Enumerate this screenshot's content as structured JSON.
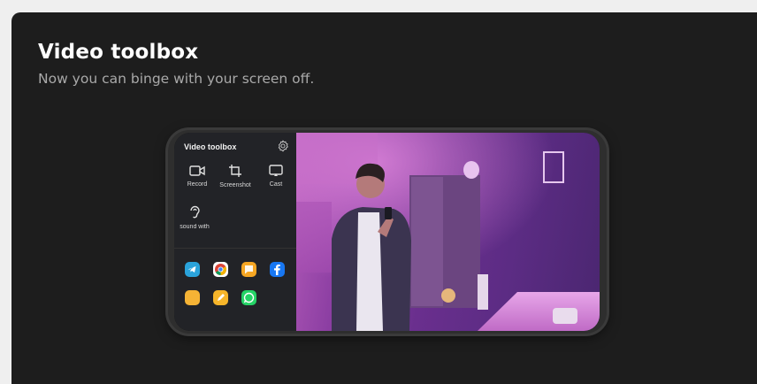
{
  "header": {
    "title": "Video toolbox",
    "subtitle": "Now you can binge with your screen off."
  },
  "toolbox": {
    "title": "Video toolbox",
    "settings_icon": "gear-icon",
    "tools": [
      {
        "label": "Record",
        "icon": "record-icon"
      },
      {
        "label": "Screenshot",
        "icon": "crop-icon"
      },
      {
        "label": "Cast",
        "icon": "cast-icon"
      },
      {
        "label": "sound with",
        "icon": "ear-icon"
      }
    ],
    "apps": [
      {
        "name": "telegram",
        "color": "#2aa3db"
      },
      {
        "name": "chrome",
        "color": "#ffffff"
      },
      {
        "name": "messages",
        "color": "#f6a623"
      },
      {
        "name": "facebook",
        "color": "#1877f2"
      },
      {
        "name": "files",
        "color": "#f5b335"
      },
      {
        "name": "notes",
        "color": "#f6b52a"
      },
      {
        "name": "whatsapp",
        "color": "#25d366"
      }
    ]
  },
  "colors": {
    "card_background": "#1d1d1d",
    "page_background": "#efefef",
    "video_tint": "#8b3ea2"
  }
}
